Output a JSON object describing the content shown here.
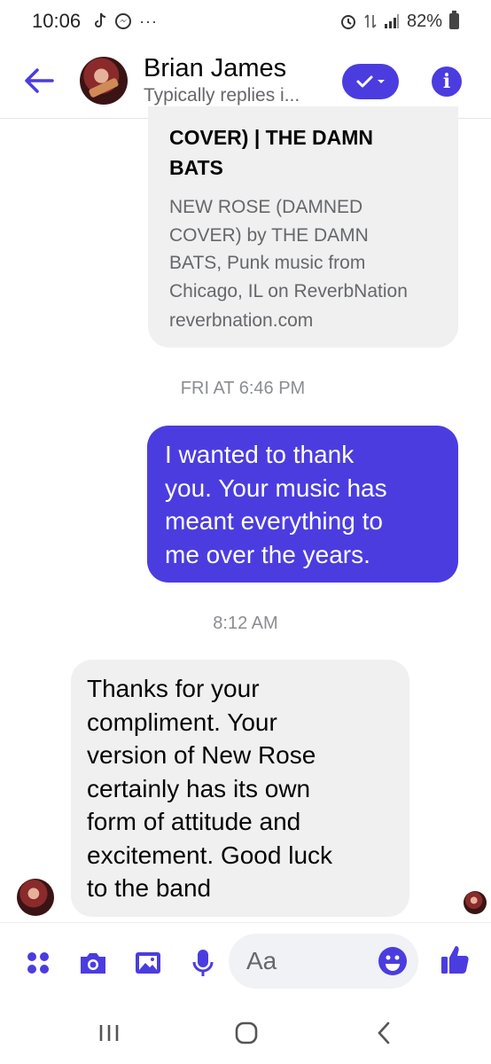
{
  "status_bar": {
    "time": "10:06",
    "battery": "82%"
  },
  "header": {
    "contact_name": "Brian James",
    "subtitle": "Typically replies i..."
  },
  "link_card": {
    "title_lines": [
      "COVER) | THE DAMN",
      "BATS"
    ],
    "description_lines": [
      "NEW ROSE (DAMNED",
      "COVER) by THE DAMN",
      "BATS, Punk music from",
      "Chicago, IL on ReverbNation"
    ],
    "domain": "reverbnation.com"
  },
  "timestamps": [
    "FRI AT 6:46 PM",
    "8:12 AM"
  ],
  "messages": {
    "outgoing_lines": [
      "I wanted to thank",
      "you. Your music has",
      "meant everything to",
      "me over the years."
    ],
    "incoming_lines": [
      "Thanks for your",
      "compliment. Your",
      "version of New Rose",
      "certainly has its own",
      "form of attitude and",
      "excitement. Good luck",
      "to the band"
    ]
  },
  "composer": {
    "placeholder": "Aa"
  },
  "colors": {
    "accent": "#4b3ce0",
    "bubble_gray": "#f0f0f0"
  },
  "icons": [
    "back-arrow-icon",
    "check-icon",
    "info-icon",
    "menu-dots-icon",
    "camera-icon",
    "image-icon",
    "microphone-icon",
    "emoji-icon",
    "thumbs-up-icon",
    "recents-icon",
    "home-icon",
    "back-icon"
  ]
}
